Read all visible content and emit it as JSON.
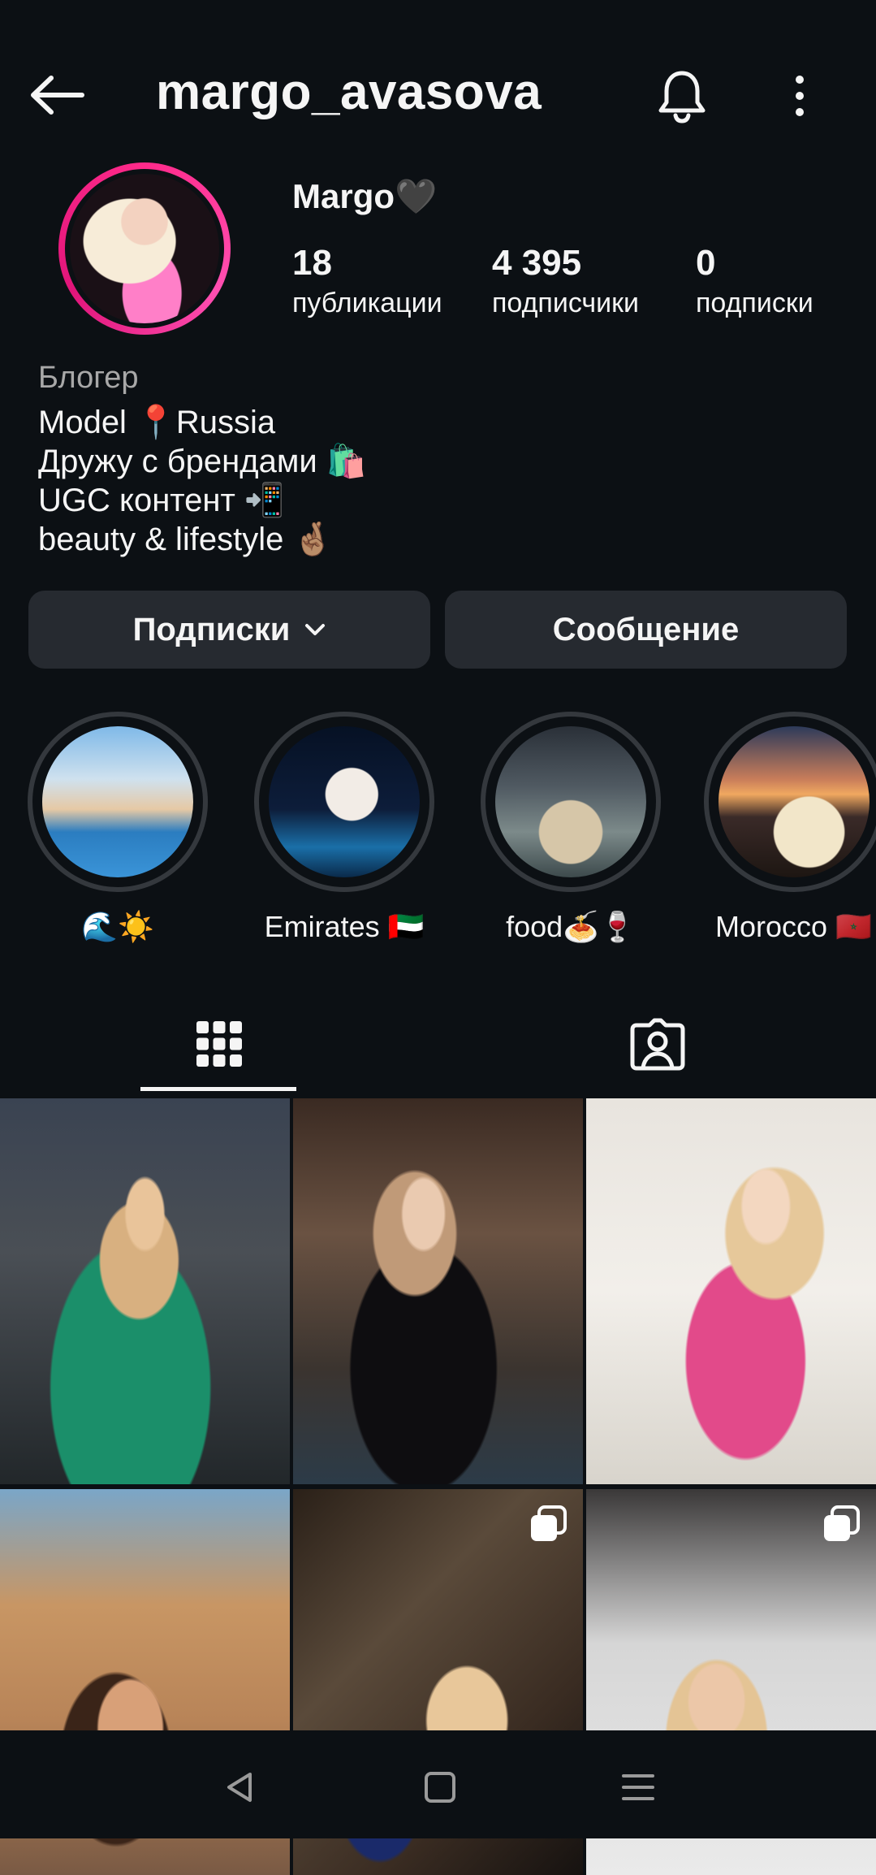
{
  "header": {
    "username": "margo_avasova"
  },
  "profile": {
    "display_name": "Margo",
    "name_emoji": "🖤",
    "stats": [
      {
        "value": "18",
        "label": "публикации"
      },
      {
        "value": "4 395",
        "label": "подписчики"
      },
      {
        "value": "0",
        "label": "подписки"
      }
    ],
    "category": "Блогер",
    "bio": [
      "Model 📍Russia",
      "Дружу с брендами 🛍️",
      "UGC контент 📲",
      "beauty & lifestyle 🤞🏽"
    ]
  },
  "actions": {
    "following_label": "Подписки",
    "message_label": "Сообщение"
  },
  "highlights": [
    {
      "label": "🌊☀️",
      "image": "pool"
    },
    {
      "label": "Emirates 🇦🇪",
      "image": "night"
    },
    {
      "label": "food🍝🍷",
      "image": "food"
    },
    {
      "label": "Morocco 🇲🇦",
      "image": "sunset"
    }
  ],
  "tabs": [
    {
      "icon": "grid-icon",
      "active": true
    },
    {
      "icon": "tagged-icon",
      "active": false
    }
  ],
  "posts": [
    {
      "multi": false
    },
    {
      "multi": false
    },
    {
      "multi": false
    },
    {
      "multi": false
    },
    {
      "multi": true
    },
    {
      "multi": true
    }
  ],
  "system_nav": [
    "back-icon",
    "home-icon",
    "recents-icon"
  ],
  "colors": {
    "background": "#0c1014",
    "button": "#262a30",
    "story_ring": "#ff2a8a",
    "highlight_ring": "#34383d",
    "muted_text": "#a8a8a8"
  }
}
